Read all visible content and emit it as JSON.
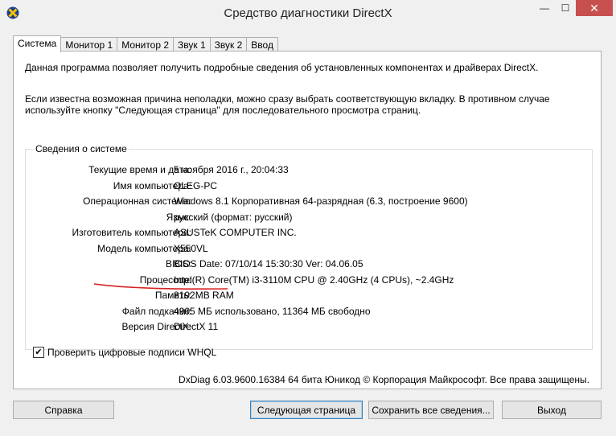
{
  "window": {
    "title": "Средство диагностики DirectX",
    "minimize": "—",
    "maximize": "☐",
    "close": "✕"
  },
  "tabs": [
    "Система",
    "Монитор 1",
    "Монитор 2",
    "Звук 1",
    "Звук 2",
    "Ввод"
  ],
  "intro": {
    "line1": "Данная программа позволяет получить подробные сведения об установленных компонентах и драйверах DirectX.",
    "line2": "Если известна возможная причина неполадки, можно сразу выбрать соответствующую вкладку. В противном случае используйте кнопку \"Следующая страница\" для последовательного просмотра страниц."
  },
  "system_info": {
    "group_title": "Сведения о системе",
    "rows": [
      {
        "label": "Текущие время и дата:",
        "value": "5 ноября 2016 г., 20:04:33"
      },
      {
        "label": "Имя компьютера:",
        "value": "OLEG-PC"
      },
      {
        "label": "Операционная система:",
        "value": "Windows 8.1 Корпоративная 64-разрядная (6.3, построение 9600)"
      },
      {
        "label": "Язык:",
        "value": "русский (формат: русский)"
      },
      {
        "label": "Изготовитель компьютера:",
        "value": "ASUSTeK COMPUTER INC."
      },
      {
        "label": "Модель компьютера:",
        "value": "X550VL"
      },
      {
        "label": "BIOS:",
        "value": "BIOS Date: 07/10/14 15:30:30 Ver: 04.06.05"
      },
      {
        "label": "Процессор:",
        "value": "Intel(R) Core(TM) i3-3110M CPU @ 2.40GHz (4 CPUs), ~2.4GHz"
      },
      {
        "label": "Память:",
        "value": "8192MB RAM"
      },
      {
        "label": "Файл подкачки:",
        "value": "4905 МБ использовано, 11364 МБ свободно"
      },
      {
        "label": "Версия DirectX:",
        "value": "DirectX 11"
      }
    ]
  },
  "whql": {
    "label": "Проверить цифровые подписи WHQL",
    "checked": true
  },
  "copyright": "DxDiag 6.03.9600.16384 64 бита Юникод  © Корпорация Майкрософт. Все права защищены.",
  "buttons": {
    "help": "Справка",
    "next": "Следующая страница",
    "save": "Сохранить все сведения...",
    "exit": "Выход"
  },
  "colors": {
    "annotation": "#d62020",
    "close_button": "#c7504f"
  }
}
